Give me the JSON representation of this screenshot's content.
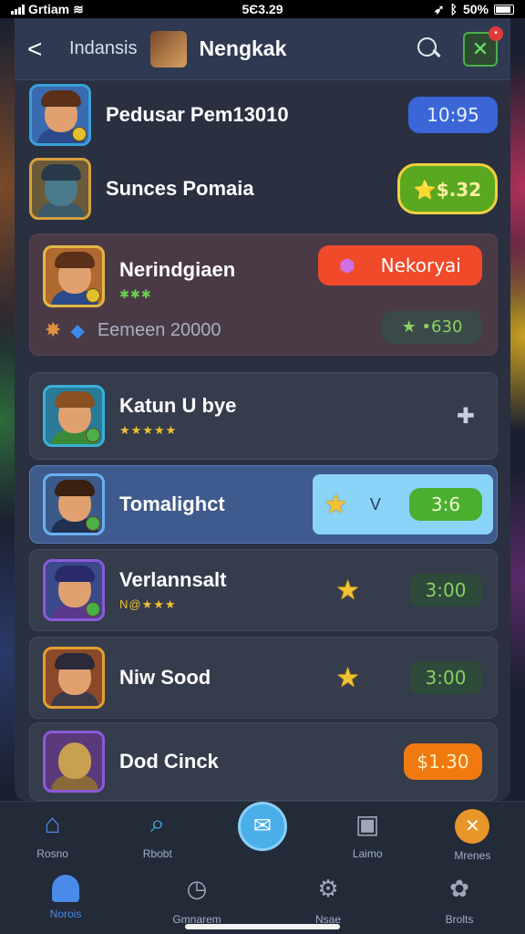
{
  "status_bar": {
    "carrier": "Grtiam",
    "time": "5Є3.29",
    "battery": "50%"
  },
  "header": {
    "back_label": "<",
    "breadcrumb": "Indansis",
    "title": "Nengkak"
  },
  "list": [
    {
      "name": "Pedusar Pem13010",
      "button": "10:95",
      "button_color": "#3a66d8"
    },
    {
      "name": "Sunces Pomaia",
      "button": "⭐$.32",
      "button_color": "#5aa820"
    },
    {
      "name": "Nerindgiaen",
      "sub": "✱✱✱",
      "action": "Nekoryai",
      "action_color": "#f04a2a",
      "footer_text": "Eemeen  20000",
      "footer_value": "★ •630"
    },
    {
      "name": "Katun U bye",
      "sub": "★★★★★",
      "side_icon": "✚"
    },
    {
      "name": "Tomalighct",
      "time": "3:6",
      "mid": "V"
    },
    {
      "name": "Verlannsalt",
      "sub": "N@★★★",
      "time": "3:00"
    },
    {
      "name": "Niw Sood",
      "time": "3:00"
    },
    {
      "name": "Dod Cinck",
      "price": "$1.30",
      "price_color": "#f07a10"
    }
  ],
  "nav_top": [
    {
      "label": "Rosno",
      "icon": "home-icon"
    },
    {
      "label": "Rbobt",
      "icon": "search-icon"
    },
    {
      "label": "",
      "icon": "send-icon"
    },
    {
      "label": "Laimo",
      "icon": "gift-icon"
    },
    {
      "label": "Mrenes",
      "icon": "crossed-swords-icon"
    }
  ],
  "nav_bottom": [
    {
      "label": "Norois",
      "icon": "home-icon"
    },
    {
      "label": "Gmnarem",
      "icon": "clock-icon"
    },
    {
      "label": "Nsae",
      "icon": "settings-icon"
    },
    {
      "label": "Brolts",
      "icon": "people-icon"
    }
  ]
}
